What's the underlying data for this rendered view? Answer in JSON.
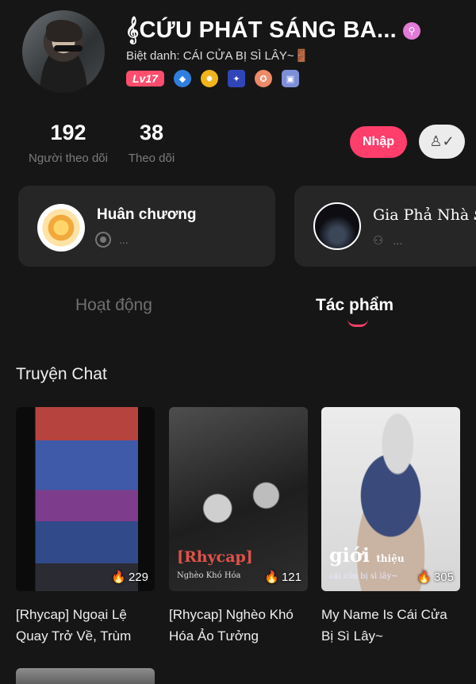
{
  "profile": {
    "name": "𝄞CỨU PHÁT SÁNG BA...",
    "nickname": "Biệt danh: CÁI CỬA BỊ SÌ LÂY~🚪",
    "level": "Lv17",
    "badges": [
      "diamond-badge-icon",
      "sun-badge-icon",
      "sparkle-badge-icon",
      "crest-badge-icon",
      "shield-badge-icon"
    ]
  },
  "stats": [
    {
      "value": "192",
      "label": "Người theo dõi"
    },
    {
      "value": "38",
      "label": "Theo dõi"
    }
  ],
  "actions": {
    "join": "Nhập"
  },
  "cards": [
    {
      "title": "Huân chương",
      "sub": "..."
    },
    {
      "title": "Gia Phả Nhà",
      "title_more": "S",
      "sub": "..."
    }
  ],
  "tabs": [
    {
      "label": "Hoạt động",
      "active": false
    },
    {
      "label": "Tác phẩm",
      "active": true
    }
  ],
  "section": {
    "title": "Truyện Chat"
  },
  "stories": [
    {
      "title": "[Rhycap] Ngoại Lệ Quay Trở Về, Trùm",
      "views": "229",
      "overlay": "",
      "overlay_sub": ""
    },
    {
      "title": "[Rhycap] Nghèo Khó Hóa Ảo Tưởng",
      "views": "121",
      "overlay": "[Rhycap]",
      "overlay_sub": "Nghèo Khó Hóa"
    },
    {
      "title": "My Name Is Cái Cửa Bị Sì Lây~",
      "views": "305",
      "overlay": "giới",
      "overlay_small": "thiệu",
      "overlay_sub": "cái cửa bị sì lây~"
    }
  ],
  "colors": {
    "accent": "#ff3e6c",
    "background": "#161616",
    "card": "#262626"
  }
}
